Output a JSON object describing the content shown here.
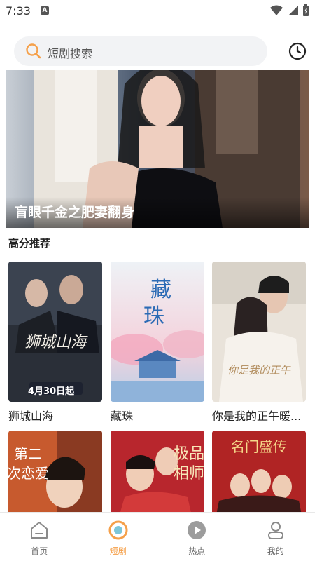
{
  "status_bar": {
    "time": "7:33",
    "badge": "A"
  },
  "search": {
    "placeholder": "短剧搜索"
  },
  "banner": {
    "title": "盲眼千金之肥妻翻身"
  },
  "section": {
    "title": "高分推荐"
  },
  "dramas": [
    {
      "name": "狮城山海",
      "poster_text": "4月30日起"
    },
    {
      "name": "藏珠"
    },
    {
      "name": "你是我的正午暖..."
    },
    {
      "name": ""
    },
    {
      "name": ""
    },
    {
      "name": ""
    }
  ],
  "nav": [
    {
      "label": "首页",
      "icon": "home-icon"
    },
    {
      "label": "短剧",
      "icon": "drama-icon",
      "active": true
    },
    {
      "label": "热点",
      "icon": "play-icon"
    },
    {
      "label": "我的",
      "icon": "profile-icon"
    }
  ],
  "colors": {
    "accent": "#f5a04a",
    "search_bg": "#f2f3f5"
  }
}
